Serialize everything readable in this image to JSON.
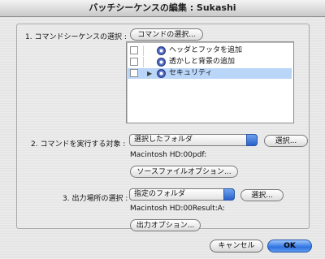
{
  "window": {
    "title": "バッチシーケンスの編集 : Sukashi"
  },
  "section1": {
    "label": "1. コマンドシーケンスの選択 :",
    "select_button": "コマンドの選択...",
    "commands": [
      {
        "label": "ヘッダとフッタを追加",
        "checked": false,
        "expanded_arrow": false,
        "selected": false
      },
      {
        "label": "透かしと背景の追加",
        "checked": false,
        "expanded_arrow": false,
        "selected": false
      },
      {
        "label": "セキュリティ",
        "checked": false,
        "expanded_arrow": true,
        "selected": true
      }
    ]
  },
  "section2": {
    "label": "2. コマンドを実行する対象 :",
    "popup_value": "選択したフォルダ",
    "choose_button": "選択...",
    "path": "Macintosh HD:00pdf:",
    "source_options_button": "ソースファイルオプション..."
  },
  "section3": {
    "label": "3. 出力場所の選択 :",
    "popup_value": "指定のフォルダ",
    "choose_button": "選択...",
    "path": "Macintosh HD:00Result:A:",
    "output_options_button": "出力オプション..."
  },
  "footer": {
    "cancel": "キャンセル",
    "ok": "OK"
  },
  "colors": {
    "default_button": "#3a7ae6",
    "selection": "#b9d5f8"
  }
}
